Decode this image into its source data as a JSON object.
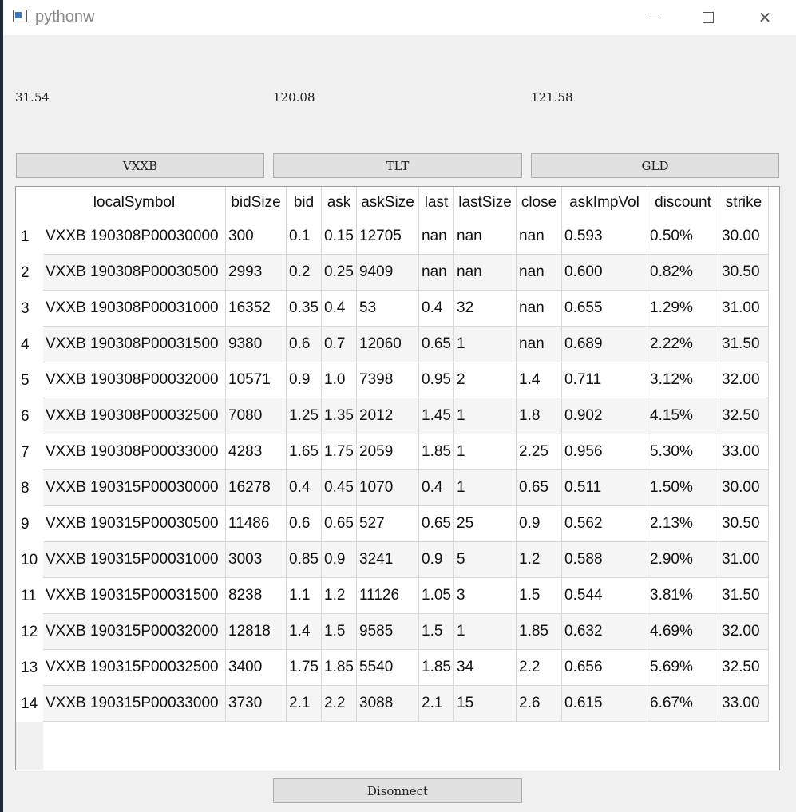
{
  "window": {
    "title": "pythonw"
  },
  "prices": [
    "31.54",
    "120.08",
    "121.58"
  ],
  "buttons": {
    "vxxb": "VXXB",
    "tlt": "TLT",
    "gld": "GLD",
    "disconnect": "Disonnect"
  },
  "table": {
    "columns": [
      "localSymbol",
      "bidSize",
      "bid",
      "ask",
      "askSize",
      "last",
      "lastSize",
      "close",
      "askImpVol",
      "discount",
      "strike"
    ],
    "rows": [
      [
        "VXXB  190308P00030000",
        "300",
        "0.1",
        "0.15",
        "12705",
        "nan",
        "nan",
        "nan",
        "0.593",
        "0.50%",
        "30.00"
      ],
      [
        "VXXB  190308P00030500",
        "2993",
        "0.2",
        "0.25",
        "9409",
        "nan",
        "nan",
        "nan",
        "0.600",
        "0.82%",
        "30.50"
      ],
      [
        "VXXB  190308P00031000",
        "16352",
        "0.35",
        "0.4",
        "53",
        "0.4",
        "32",
        "nan",
        "0.655",
        "1.29%",
        "31.00"
      ],
      [
        "VXXB  190308P00031500",
        "9380",
        "0.6",
        "0.7",
        "12060",
        "0.65",
        "1",
        "nan",
        "0.689",
        "2.22%",
        "31.50"
      ],
      [
        "VXXB  190308P00032000",
        "10571",
        "0.9",
        "1.0",
        "7398",
        "0.95",
        "2",
        "1.4",
        "0.711",
        "3.12%",
        "32.00"
      ],
      [
        "VXXB  190308P00032500",
        "7080",
        "1.25",
        "1.35",
        "2012",
        "1.45",
        "1",
        "1.8",
        "0.902",
        "4.15%",
        "32.50"
      ],
      [
        "VXXB  190308P00033000",
        "4283",
        "1.65",
        "1.75",
        "2059",
        "1.85",
        "1",
        "2.25",
        "0.956",
        "5.30%",
        "33.00"
      ],
      [
        "VXXB  190315P00030000",
        "16278",
        "0.4",
        "0.45",
        "1070",
        "0.4",
        "1",
        "0.65",
        "0.511",
        "1.50%",
        "30.00"
      ],
      [
        "VXXB  190315P00030500",
        "11486",
        "0.6",
        "0.65",
        "527",
        "0.65",
        "25",
        "0.9",
        "0.562",
        "2.13%",
        "30.50"
      ],
      [
        "VXXB  190315P00031000",
        "3003",
        "0.85",
        "0.9",
        "3241",
        "0.9",
        "5",
        "1.2",
        "0.588",
        "2.90%",
        "31.00"
      ],
      [
        "VXXB  190315P00031500",
        "8238",
        "1.1",
        "1.2",
        "11126",
        "1.05",
        "3",
        "1.5",
        "0.544",
        "3.81%",
        "31.50"
      ],
      [
        "VXXB  190315P00032000",
        "12818",
        "1.4",
        "1.5",
        "9585",
        "1.5",
        "1",
        "1.85",
        "0.632",
        "4.69%",
        "32.00"
      ],
      [
        "VXXB  190315P00032500",
        "3400",
        "1.75",
        "1.85",
        "5540",
        "1.85",
        "34",
        "2.2",
        "0.656",
        "5.69%",
        "32.50"
      ],
      [
        "VXXB  190315P00033000",
        "3730",
        "2.1",
        "2.2",
        "3088",
        "2.1",
        "15",
        "2.6",
        "0.615",
        "6.67%",
        "33.00"
      ]
    ]
  }
}
